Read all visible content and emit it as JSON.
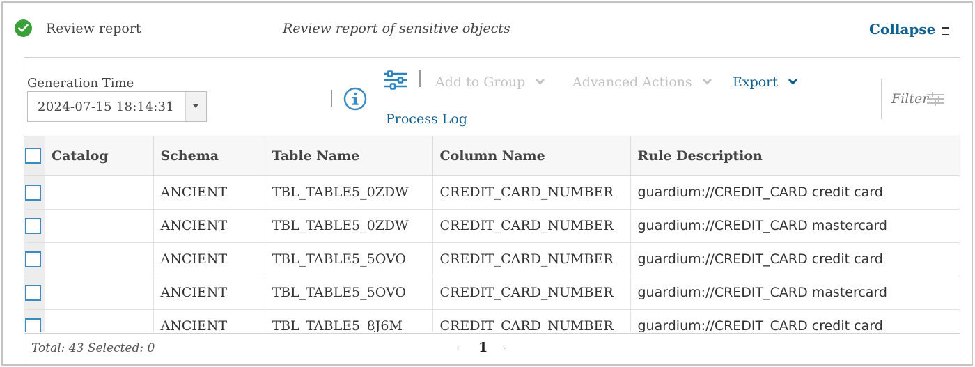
{
  "header": {
    "title": "Review report",
    "subtitle": "Review report of sensitive objects",
    "collapse_label": "Collapse",
    "status_color": "#3aa13a"
  },
  "toolbar": {
    "generation_label": "Generation Time",
    "generation_value": "2024-07-15 18:14:31",
    "add_to_group": "Add to Group",
    "advanced_actions": "Advanced Actions",
    "export": "Export",
    "process_log": "Process Log",
    "filter_placeholder": "Filter"
  },
  "table": {
    "columns": [
      "Catalog",
      "Schema",
      "Table Name",
      "Column Name",
      "Rule Description"
    ],
    "rows": [
      [
        "",
        "ANCIENT",
        "TBL_TABLE5_0ZDW",
        "CREDIT_CARD_NUMBER",
        "guardium://CREDIT_CARD credit card"
      ],
      [
        "",
        "ANCIENT",
        "TBL_TABLE5_0ZDW",
        "CREDIT_CARD_NUMBER",
        "guardium://CREDIT_CARD mastercard"
      ],
      [
        "",
        "ANCIENT",
        "TBL_TABLE5_5OVO",
        "CREDIT_CARD_NUMBER",
        "guardium://CREDIT_CARD credit card"
      ],
      [
        "",
        "ANCIENT",
        "TBL_TABLE5_5OVO",
        "CREDIT_CARD_NUMBER",
        "guardium://CREDIT_CARD mastercard"
      ],
      [
        "",
        "ANCIENT",
        "TBL_TABLE5_8J6M",
        "CREDIT_CARD_NUMBER",
        "guardium://CREDIT_CARD credit card"
      ]
    ]
  },
  "footer": {
    "total_text": "Total: 43 Selected: 0",
    "current_page": "1"
  },
  "colors": {
    "link": "#10608f",
    "disabled": "#c3c3c3",
    "checkbox": "#3a8bc0"
  }
}
